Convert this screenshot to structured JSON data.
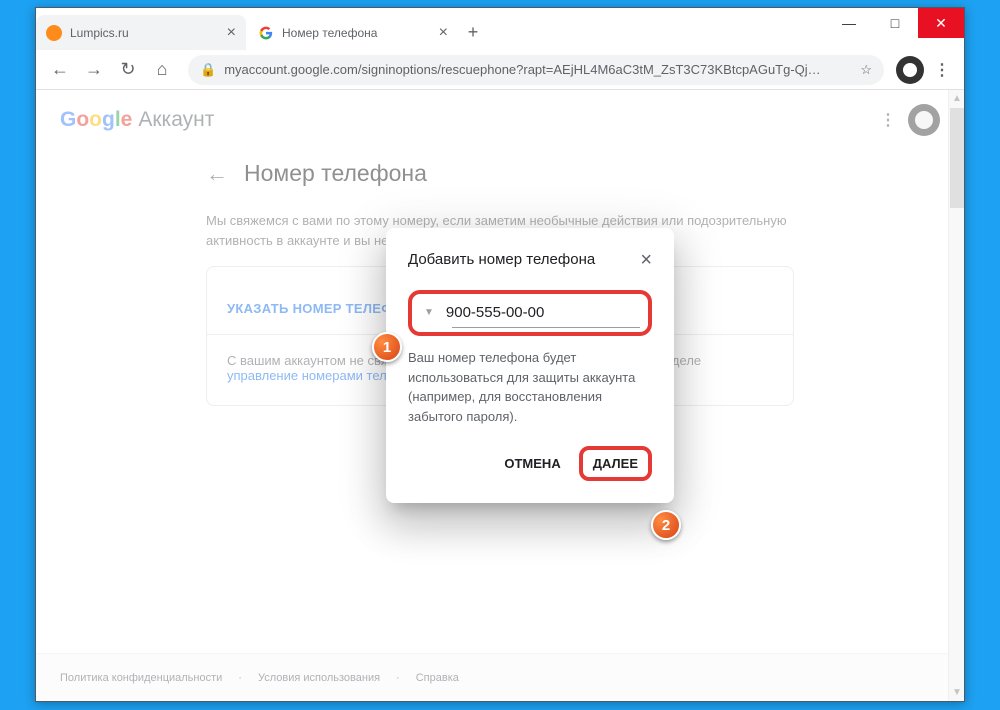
{
  "window": {
    "minimize": "—",
    "maximize": "□",
    "close": "✕"
  },
  "tabs": {
    "lumpics": "Lumpics.ru",
    "phone": "Номер телефона"
  },
  "toolbar": {
    "url": "myaccount.google.com/signinoptions/rescuephone?rapt=AEjHL4M6aC3tM_ZsT3C73KBtcpAGuTg-Qj…"
  },
  "header": {
    "logo": {
      "g1": "G",
      "o1": "o",
      "o2": "o",
      "g2": "g",
      "l": "l",
      "e": "e"
    },
    "app": "Аккаунт"
  },
  "page": {
    "title": "Номер телефона",
    "desc": "Мы свяжемся с вами по этому номеру, если заметим необычные действия или подозрительную активность в аккаунте и вы не сможете войти в аккаунт.",
    "card_action": "УКАЗАТЬ НОМЕР ТЕЛЕФОНА",
    "card_text": "С вашим аккаунтом не связан номер телефона. Подробнее об этом в разделе ",
    "card_link": "управление номерами телефонов"
  },
  "dialog": {
    "title": "Добавить номер телефона",
    "phone": "900-555-00-00",
    "desc": "Ваш номер телефона будет использоваться для защиты аккаунта (например, для восстановления забытого пароля).",
    "cancel": "ОТМЕНА",
    "next": "ДАЛЕЕ"
  },
  "footer": {
    "privacy": "Политика конфиденциальности",
    "terms": "Условия использования",
    "help": "Справка"
  },
  "markers": {
    "m1": "1",
    "m2": "2"
  }
}
